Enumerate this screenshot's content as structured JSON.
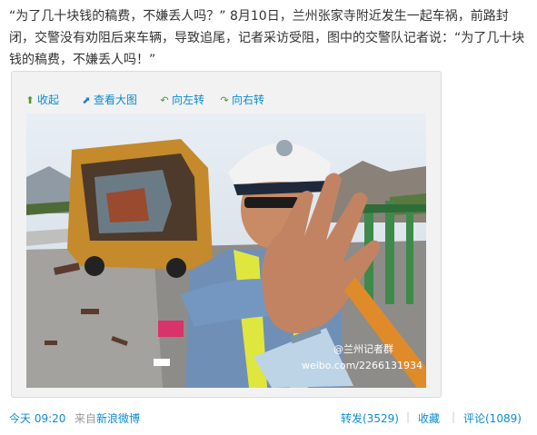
{
  "post": {
    "quote_open": "“为了几十块钱的稿费，不嫌丢人吗？”",
    "date": "8月10日，",
    "body": "兰州张家寺附近发生一起车祸，前路封闭，交警没有劝阻后来车辆，导致追尾，记者采访受阻，图中的交警队记者说：",
    "quote_close": "“为了几十块钱的稿费，不嫌丢人吗！”"
  },
  "toolbar": {
    "collapse": "收起",
    "view_large": "查看大图",
    "rotate_left": "向左转",
    "rotate_right": "向右转"
  },
  "photo": {
    "watermark_handle": "@兰州记者群",
    "watermark_url": "weibo.com/2266131934"
  },
  "footer": {
    "time": "今天 09:20",
    "source_prefix": "来自",
    "source": "新浪微博",
    "repost": "转发(3529)",
    "favorite": "收藏",
    "comment": "评论(1089)",
    "separator": "|"
  },
  "colors": {
    "link": "#0a8cd2",
    "text": "#333333",
    "muted": "#999999"
  }
}
